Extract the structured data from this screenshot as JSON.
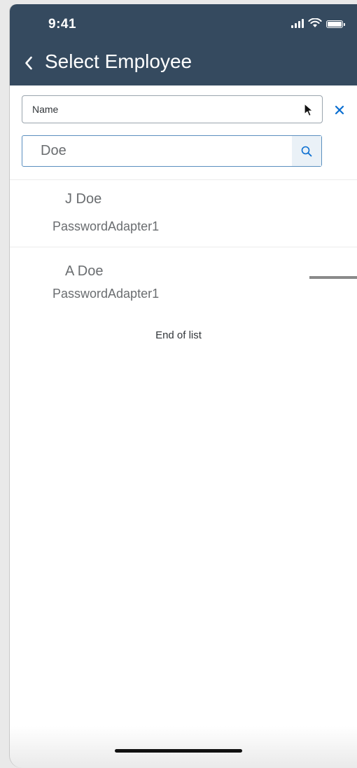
{
  "status_bar": {
    "time": "9:41",
    "signal_icon": "cellular-signal-icon",
    "wifi_icon": "wifi-icon",
    "battery_icon": "battery-icon"
  },
  "header": {
    "back_icon": "chevron-left-icon",
    "title": "Select Employee",
    "background_color": "#354a5f"
  },
  "filter": {
    "selected_value": "Name",
    "clear_icon": "close-icon"
  },
  "search": {
    "value": "Doe",
    "icon": "search-icon",
    "accent_color": "#0a6ed1"
  },
  "results": [
    {
      "name": "J Doe",
      "subtitle": "PasswordAdapter1"
    },
    {
      "name": "A Doe",
      "subtitle": "PasswordAdapter1"
    }
  ],
  "footer": {
    "end_text": "End of list"
  }
}
